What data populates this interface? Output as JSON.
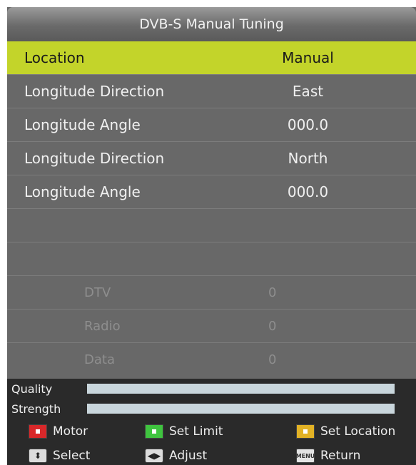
{
  "title": "DVB-S Manual Tuning",
  "rows": [
    {
      "label": "Location",
      "value": "Manual"
    },
    {
      "label": "Longitude Direction",
      "value": "East"
    },
    {
      "label": "Longitude Angle",
      "value": "000.0"
    },
    {
      "label": "Longitude Direction",
      "value": "North"
    },
    {
      "label": "Longitude Angle",
      "value": "000.0"
    }
  ],
  "counts": [
    {
      "label": "DTV",
      "value": "0"
    },
    {
      "label": "Radio",
      "value": "0"
    },
    {
      "label": "Data",
      "value": "0"
    }
  ],
  "meters": {
    "quality": {
      "label": "Quality",
      "level": 1.0
    },
    "strength": {
      "label": "Strength",
      "level": 1.0
    }
  },
  "keys": {
    "motor": "Motor",
    "set_limit": "Set Limit",
    "set_location": "Set Location",
    "select": "Select",
    "adjust": "Adjust",
    "menu_chip": "MENU",
    "return": "Return"
  },
  "colors": {
    "selected_row": "#c3d42a",
    "panel": "#686868",
    "red_key": "#d8282a",
    "green_key": "#3fc43f",
    "yellow_key": "#e2b225"
  }
}
